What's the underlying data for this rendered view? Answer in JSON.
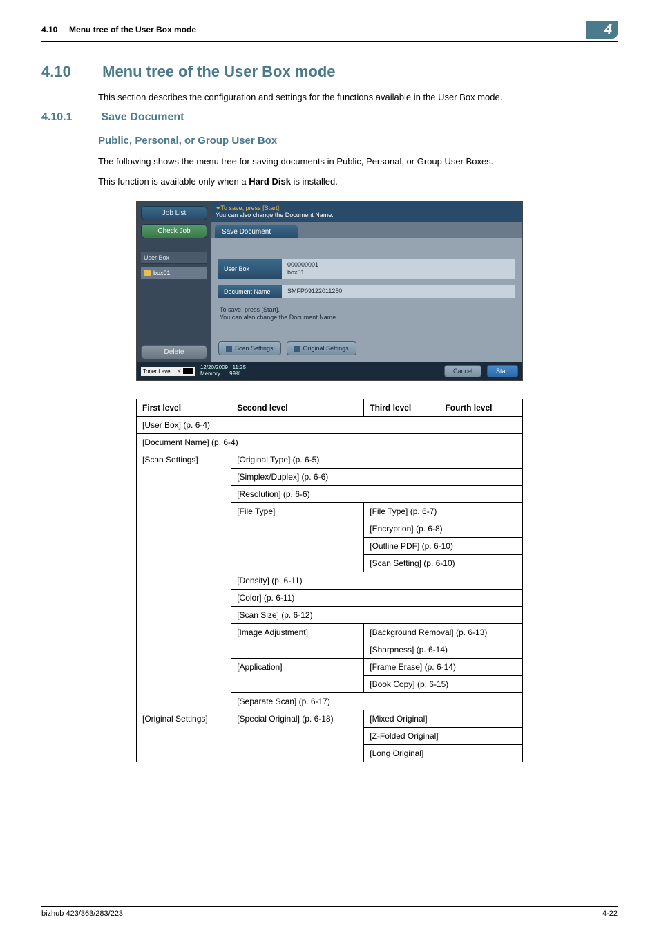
{
  "header": {
    "section_ref": "4.10",
    "section_label": "Menu tree of the User Box mode",
    "chapter_num": "4"
  },
  "titles": {
    "h1_num": "4.10",
    "h1_text": "Menu tree of the User Box mode",
    "intro": "This section describes the configuration and settings for the functions available in the User Box mode.",
    "h2_num": "4.10.1",
    "h2_text": "Save Document",
    "h3_text": "Public, Personal, or Group User Box",
    "para1": "The following shows the menu tree for saving documents in Public, Personal, or Group User Boxes.",
    "para2_a": "This function is available only when a ",
    "para2_b": "Hard Disk",
    "para2_c": " is installed."
  },
  "screenshot": {
    "job_list": "Job List",
    "check_job": "Check Job",
    "user_box_label": "User Box",
    "box_item": "box01",
    "delete": "Delete",
    "hint_line1": "To save, press [Start].",
    "hint_line2": "You can also change the Document Name.",
    "tab": "Save Document",
    "row1_label": "User Box",
    "row1_val1": "000000001",
    "row1_val2": "box01",
    "row2_label": "Document Name",
    "row2_val": "SMFP09122011250",
    "note1": "To save, press [Start].",
    "note2": "You can also change the Document Name.",
    "btn_scan": "Scan Settings",
    "btn_orig": "Original Settings",
    "toner": "Toner Level",
    "toner_k": "K",
    "date": "12/20/2009",
    "time": "11:25",
    "memory": "Memory",
    "mem_pct": "99%",
    "cancel": "Cancel",
    "start": "Start"
  },
  "table": {
    "headers": {
      "c1": "First level",
      "c2": "Second level",
      "c3": "Third level",
      "c4": "Fourth level"
    },
    "r1": "[User Box] (p. 6-4)",
    "r2": "[Document Name] (p. 6-4)",
    "scan_settings": "[Scan Settings]",
    "original_type": "[Original Type] (p. 6-5)",
    "simplex": "[Simplex/Duplex] (p. 6-6)",
    "resolution": "[Resolution] (p. 6-6)",
    "file_type": "[File Type]",
    "file_type_3": "[File Type] (p. 6-7)",
    "encryption": "[Encryption] (p. 6-8)",
    "outline_pdf": "[Outline PDF] (p. 6-10)",
    "scan_setting": "[Scan Setting] (p. 6-10)",
    "density": "[Density] (p. 6-11)",
    "color": "[Color] (p. 6-11)",
    "scan_size": "[Scan Size] (p. 6-12)",
    "image_adjust": "[Image Adjustment]",
    "bg_removal": "[Background Removal] (p. 6-13)",
    "sharpness": "[Sharpness] (p. 6-14)",
    "application": "[Application]",
    "frame_erase": "[Frame Erase] (p. 6-14)",
    "book_copy": "[Book Copy] (p. 6-15)",
    "separate_scan": "[Separate Scan] (p. 6-17)",
    "original_settings": "[Original Settings]",
    "special_original": "[Special Original] (p. 6-18)",
    "mixed": "[Mixed Original]",
    "zfolded": "[Z-Folded Original]",
    "long": "[Long Original]"
  },
  "footer": {
    "left": "bizhub 423/363/283/223",
    "right": "4-22"
  }
}
